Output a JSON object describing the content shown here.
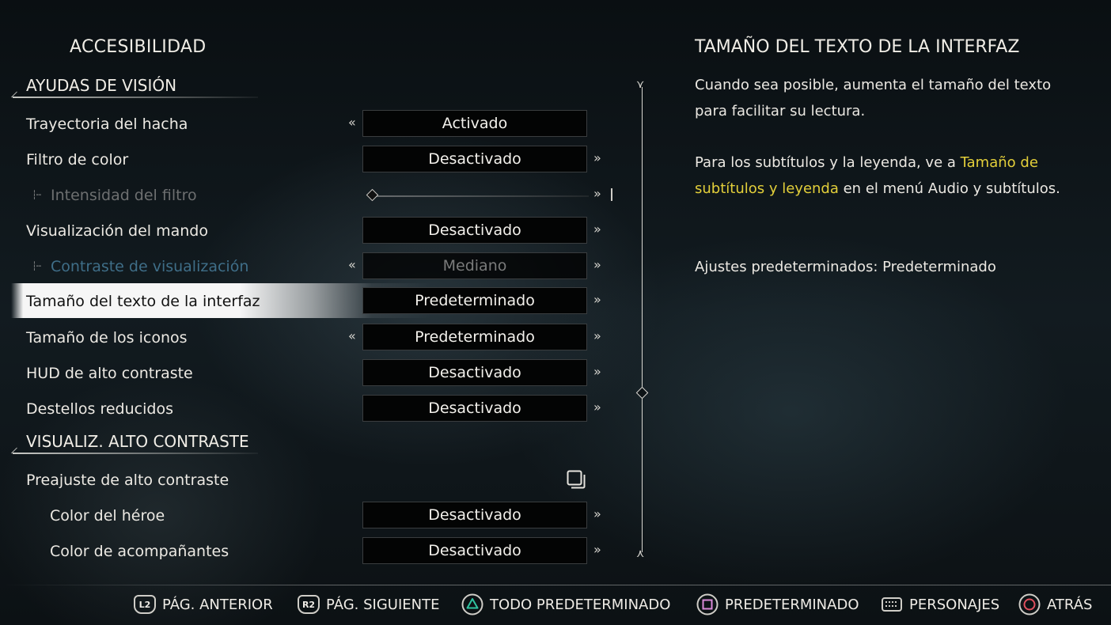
{
  "page": {
    "title": "ACCESIBILIDAD"
  },
  "sections": {
    "vision": "AYUDAS DE VISIÓN",
    "high_contrast": "VISUALIZ. ALTO CONTRASTE"
  },
  "settings": [
    {
      "label": "Trayectoria del hacha",
      "value": "Activado"
    },
    {
      "label": "Filtro de color",
      "value": "Desactivado"
    },
    {
      "label": "Intensidad del filtro",
      "value": "",
      "slider_level": 0.0
    },
    {
      "label": "Visualización del mando",
      "value": "Desactivado"
    },
    {
      "label": "Contraste de visualización",
      "value": "Mediano"
    },
    {
      "label": "Tamaño del texto de la interfaz",
      "value": "Predeterminado"
    },
    {
      "label": "Tamaño de los iconos",
      "value": "Predeterminado"
    },
    {
      "label": "HUD de alto contraste",
      "value": "Desactivado"
    },
    {
      "label": "Destellos reducidos",
      "value": "Desactivado"
    },
    {
      "label": "Preajuste de alto contraste",
      "value": ""
    },
    {
      "label": "Color del héroe",
      "value": "Desactivado"
    },
    {
      "label": "Color de acompañantes",
      "value": "Desactivado"
    }
  ],
  "arrows": {
    "left": "«",
    "right": "»"
  },
  "description": {
    "title": "TAMAÑO DEL TEXTO DE LA INTERFAZ",
    "para1": "Cuando sea posible, aumenta el tamaño del texto para facilitar su lectura.",
    "para2_a": "Para los subtítulos y la leyenda, ve a ",
    "para2_link": "Tamaño de subtítulos y leyenda",
    "para2_b": " en el menú Audio y subtítulos.",
    "para3": "Ajustes predeterminados: Predeterminado"
  },
  "footer": {
    "prev_page_button": "L2",
    "prev_page": "PÁG. ANTERIOR",
    "next_page_button": "R2",
    "next_page": "PÁG. SIGUIENTE",
    "all_default": "TODO PREDETERMINADO",
    "default": "PREDETERMINADO",
    "characters": "PERSONAJES",
    "back": "ATRÁS"
  },
  "colors": {
    "highlight": "#e3cf3a",
    "triangle": "#2fc4a0",
    "square": "#d98ad8",
    "circle": "#e0505e",
    "disabled_blue": "#3f6e88"
  },
  "icons": {
    "triangle": "triangle-icon",
    "square": "square-icon",
    "circle": "circle-icon",
    "touchpad": "touchpad-icon",
    "preset": "preset-icon"
  }
}
